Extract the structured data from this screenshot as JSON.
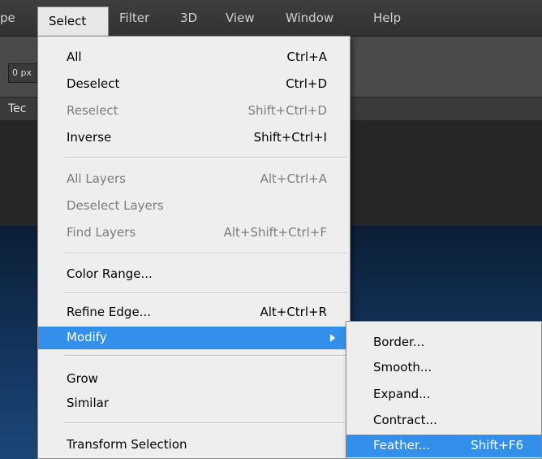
{
  "menubar": {
    "items": [
      "pe",
      "Select",
      "Filter",
      "3D",
      "View",
      "Window",
      "Help"
    ],
    "active": "Select"
  },
  "options_bar": {
    "field_value": "0 px"
  },
  "document_tab": {
    "label": "Tec"
  },
  "select_menu": {
    "all": {
      "label": "All",
      "shortcut": "Ctrl+A"
    },
    "deselect": {
      "label": "Deselect",
      "shortcut": "Ctrl+D"
    },
    "reselect": {
      "label": "Reselect",
      "shortcut": "Shift+Ctrl+D"
    },
    "inverse": {
      "label": "Inverse",
      "shortcut": "Shift+Ctrl+I"
    },
    "all_layers": {
      "label": "All Layers",
      "shortcut": "Alt+Ctrl+A"
    },
    "deselect_layers": {
      "label": "Deselect Layers"
    },
    "find_layers": {
      "label": "Find Layers",
      "shortcut": "Alt+Shift+Ctrl+F"
    },
    "color_range": {
      "label": "Color Range..."
    },
    "refine_edge": {
      "label": "Refine Edge...",
      "shortcut": "Alt+Ctrl+R"
    },
    "modify": {
      "label": "Modify"
    },
    "grow": {
      "label": "Grow"
    },
    "similar": {
      "label": "Similar"
    },
    "transform_selection": {
      "label": "Transform Selection"
    }
  },
  "modify_submenu": {
    "border": {
      "label": "Border..."
    },
    "smooth": {
      "label": "Smooth..."
    },
    "expand": {
      "label": "Expand..."
    },
    "contract": {
      "label": "Contract..."
    },
    "feather": {
      "label": "Feather...",
      "shortcut": "Shift+F6"
    }
  },
  "colors": {
    "highlight": "#3390ea",
    "menu_bg": "#eeeeee",
    "disabled_text": "#7d7d7d"
  },
  "icons": [
    "submenu-arrow-icon"
  ]
}
